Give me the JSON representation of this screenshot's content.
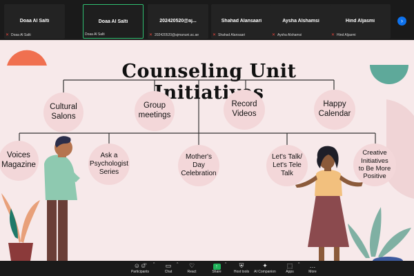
{
  "participants": [
    {
      "name": "Doaa Al Salti",
      "footer": "Doaa Al Salti",
      "muted": true,
      "active": false
    },
    {
      "name": "Doaa Al Salti",
      "footer": "Doaa Al Salti",
      "muted": false,
      "active": true
    },
    {
      "name": "202420520@aj...",
      "footer": "202420520@ajmanuni.ac.ae",
      "muted": true,
      "active": false
    },
    {
      "name": "Shahad Alansaari",
      "footer": "Shahad Alansaari",
      "muted": true,
      "active": false
    },
    {
      "name": "Aysha Alshamsi",
      "footer": "Aysha Alshamsi",
      "muted": true,
      "active": false
    },
    {
      "name": "Hind Aljasmi",
      "footer": "Hind Aljasmi",
      "muted": true,
      "active": false
    }
  ],
  "slide": {
    "title": "Counseling Unit Initiatives",
    "top_items": [
      {
        "lines": [
          "Cultural",
          "Salons"
        ]
      },
      {
        "lines": [
          "Group",
          "meetings"
        ]
      },
      {
        "lines": [
          "Record",
          "Videos"
        ]
      },
      {
        "lines": [
          "Happy",
          "Calendar"
        ]
      }
    ],
    "bottom_items": [
      {
        "lines": [
          "Voices",
          "Magazine"
        ]
      },
      {
        "lines": [
          "Ask a",
          "Psychologist",
          "Series"
        ]
      },
      {
        "lines": [
          "Mother's",
          "Day",
          "Celebration"
        ]
      },
      {
        "lines": [
          "Let's Talk/",
          "Let's Tele",
          "Talk"
        ]
      },
      {
        "lines": [
          "Creative",
          "Initiatives",
          "to Be More",
          "Positive"
        ]
      }
    ]
  },
  "toolbar": {
    "participants_count": "39",
    "items": [
      {
        "label": "Participants",
        "icon": "participants-icon"
      },
      {
        "label": "Chat",
        "icon": "chat-icon"
      },
      {
        "label": "React",
        "icon": "react-icon"
      },
      {
        "label": "Share",
        "icon": "share-icon"
      },
      {
        "label": "Host tools",
        "icon": "shield-icon"
      },
      {
        "label": "AI Companion",
        "icon": "sparkle-icon"
      },
      {
        "label": "Apps",
        "icon": "apps-icon"
      },
      {
        "label": "More",
        "icon": "more-icon"
      }
    ]
  },
  "colors": {
    "slide_bg": "#f7e9ea",
    "node_bg": "#f3d7d9",
    "active_border": "#2fbf71",
    "share_green": "#1fb25a",
    "mute_red": "#e0453b",
    "accent_blue": "#0e72ed"
  }
}
